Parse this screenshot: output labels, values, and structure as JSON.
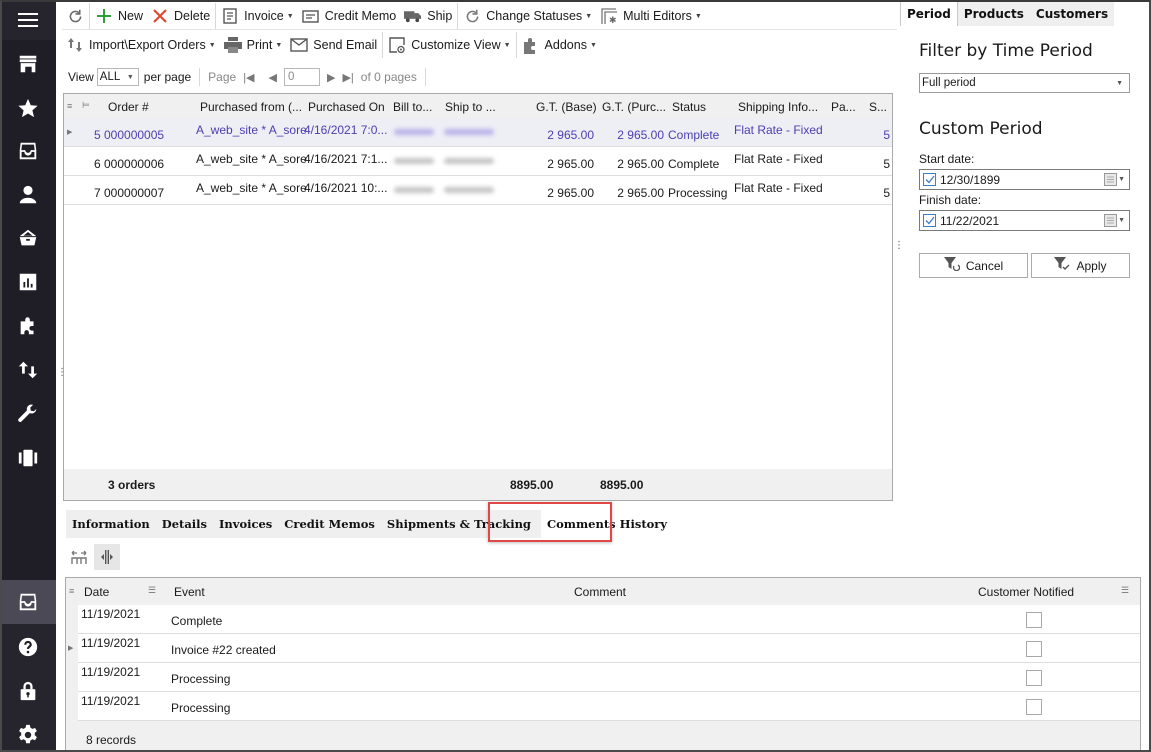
{
  "sidebar": {
    "items": [
      {
        "name": "menu",
        "icon": "hamburger-menu-icon"
      },
      {
        "name": "store",
        "icon": "store-icon"
      },
      {
        "name": "favorites",
        "icon": "star-icon"
      },
      {
        "name": "orders",
        "icon": "archive-box-icon"
      },
      {
        "name": "customers",
        "icon": "user-icon"
      },
      {
        "name": "products",
        "icon": "basket-icon"
      },
      {
        "name": "reports",
        "icon": "bar-chart-icon"
      },
      {
        "name": "addons",
        "icon": "puzzle-icon"
      },
      {
        "name": "import-export",
        "icon": "arrows-up-down-icon"
      },
      {
        "name": "tools",
        "icon": "wrench-icon"
      },
      {
        "name": "carousel",
        "icon": "carousel-icon"
      }
    ],
    "bottom_items": [
      {
        "name": "orders-active",
        "icon": "archive-box-icon",
        "active": true
      },
      {
        "name": "help",
        "icon": "question-circle-icon"
      },
      {
        "name": "lock",
        "icon": "lock-icon"
      },
      {
        "name": "settings",
        "icon": "gear-icon"
      }
    ]
  },
  "toolbar": {
    "refresh_icon": "refresh-icon",
    "new": "New",
    "delete": "Delete",
    "invoice": "Invoice",
    "credit_memo": "Credit Memo",
    "ship": "Ship",
    "change_statuses": "Change Statuses",
    "multi_editors": "Multi Editors",
    "import_export": "Import\\Export Orders",
    "print": "Print",
    "send_email": "Send Email",
    "customize_view": "Customize View",
    "addons": "Addons"
  },
  "pager": {
    "view_label": "View",
    "view_value": "ALL",
    "per_page": "per page",
    "page_label": "Page",
    "page_value": "0",
    "of_pages": "of 0 pages"
  },
  "orders_grid": {
    "columns": [
      "Order #",
      "Purchased from (...",
      "Purchased On",
      "Bill to...",
      "Ship to ...",
      "G.T. (Base)",
      "G.T. (Purc...",
      "Status",
      "Shipping Info...",
      "Pa...",
      "S..."
    ],
    "rows": [
      {
        "id": "5",
        "order": "000000005",
        "purchased_from": "A_web_site * A_sore",
        "purchased_on": "4/16/2021 7:0...",
        "gt_base": "2 965.00",
        "gt_purchased": "2 965.00",
        "status": "Complete",
        "shipping": "Flat Rate - Fixed",
        "s": "5",
        "selected": true
      },
      {
        "id": "6",
        "order": "000000006",
        "purchased_from": "A_web_site * A_sore",
        "purchased_on": "4/16/2021 7:1...",
        "gt_base": "2 965.00",
        "gt_purchased": "2 965.00",
        "status": "Complete",
        "shipping": "Flat Rate - Fixed",
        "s": "5",
        "selected": false
      },
      {
        "id": "7",
        "order": "000000007",
        "purchased_from": "A_web_site * A_sore",
        "purchased_on": "4/16/2021 10:...",
        "gt_base": "2 965.00",
        "gt_purchased": "2 965.00",
        "status": "Processing",
        "shipping": "Flat Rate - Fixed",
        "s": "5",
        "selected": false
      }
    ],
    "footer": {
      "count": "3 orders",
      "gt_base_total": "8895.00",
      "gt_purchased_total": "8895.00"
    }
  },
  "filter_panel": {
    "tabs": [
      "Period",
      "Products",
      "Customers"
    ],
    "active_tab": "Period",
    "title": "Filter by Time Period",
    "period_value": "Full period",
    "custom_title": "Custom Period",
    "start_label": "Start date:",
    "start_value": "12/30/1899",
    "start_checked": true,
    "finish_label": "Finish date:",
    "finish_value": "11/22/2021",
    "finish_checked": true,
    "cancel": "Cancel",
    "apply": "Apply"
  },
  "detail_tabs": {
    "tabs": [
      "Information",
      "Details",
      "Invoices",
      "Credit Memos",
      "Shipments & Tracking",
      "Comments History"
    ],
    "active": "Comments History"
  },
  "comments_grid": {
    "columns": [
      "Date",
      "Event",
      "Comment",
      "Customer Notified"
    ],
    "rows": [
      {
        "date": "11/19/2021",
        "event": "Complete",
        "comment": "",
        "notified": false
      },
      {
        "date": "11/19/2021",
        "event": "Invoice #22 created",
        "comment": "",
        "notified": false
      },
      {
        "date": "11/19/2021",
        "event": "Processing",
        "comment": "",
        "notified": false
      },
      {
        "date": "11/19/2021",
        "event": "Processing",
        "comment": "",
        "notified": false
      }
    ],
    "footer": "8 records"
  },
  "colors": {
    "sidebar_bg": "#1f1e26",
    "selected_row_text": "#4a3fb0",
    "highlight_border": "#e04848",
    "new_icon": "#2e9e3a",
    "delete_icon": "#e0442c"
  }
}
